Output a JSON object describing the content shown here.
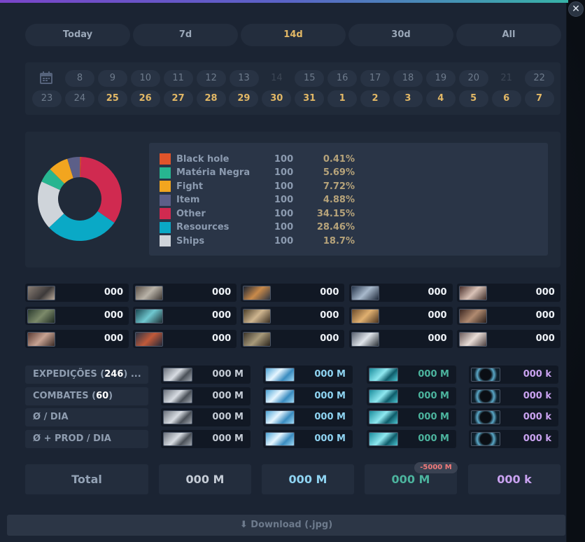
{
  "close_label": "✕",
  "tabs": [
    {
      "label": "Today",
      "active": false
    },
    {
      "label": "7d",
      "active": false
    },
    {
      "label": "14d",
      "active": true
    },
    {
      "label": "30d",
      "active": false
    },
    {
      "label": "All",
      "active": false
    }
  ],
  "calendar": {
    "icon": "calendar-icon",
    "row1": [
      {
        "d": "8",
        "s": "n"
      },
      {
        "d": "9",
        "s": "n"
      },
      {
        "d": "10",
        "s": "n"
      },
      {
        "d": "11",
        "s": "n"
      },
      {
        "d": "12",
        "s": "n"
      },
      {
        "d": "13",
        "s": "n"
      },
      {
        "d": "14",
        "s": "dis"
      },
      {
        "d": "15",
        "s": "n"
      },
      {
        "d": "16",
        "s": "n"
      },
      {
        "d": "17",
        "s": "n"
      },
      {
        "d": "18",
        "s": "n"
      },
      {
        "d": "19",
        "s": "n"
      },
      {
        "d": "20",
        "s": "n"
      },
      {
        "d": "21",
        "s": "dis"
      },
      {
        "d": "22",
        "s": "n"
      }
    ],
    "row2": [
      {
        "d": "23",
        "s": "n"
      },
      {
        "d": "24",
        "s": "n"
      },
      {
        "d": "25",
        "s": "sel"
      },
      {
        "d": "26",
        "s": "sel"
      },
      {
        "d": "27",
        "s": "sel"
      },
      {
        "d": "28",
        "s": "sel"
      },
      {
        "d": "29",
        "s": "sel"
      },
      {
        "d": "30",
        "s": "sel"
      },
      {
        "d": "31",
        "s": "sel"
      },
      {
        "d": "1",
        "s": "sel"
      },
      {
        "d": "2",
        "s": "sel"
      },
      {
        "d": "3",
        "s": "sel"
      },
      {
        "d": "4",
        "s": "sel"
      },
      {
        "d": "5",
        "s": "sel"
      },
      {
        "d": "6",
        "s": "sel"
      },
      {
        "d": "7",
        "s": "sel"
      }
    ]
  },
  "legend": [
    {
      "name": "Black hole",
      "count": "100",
      "pct": "0.41%",
      "color": "#e0542a"
    },
    {
      "name": "Matéria Negra",
      "count": "100",
      "pct": "5.69%",
      "color": "#27b590"
    },
    {
      "name": "Fight",
      "count": "100",
      "pct": "7.72%",
      "color": "#f2a51f"
    },
    {
      "name": "Item",
      "count": "100",
      "pct": "4.88%",
      "color": "#5c5f88"
    },
    {
      "name": "Other",
      "count": "100",
      "pct": "34.15%",
      "color": "#d02a50"
    },
    {
      "name": "Resources",
      "count": "100",
      "pct": "28.46%",
      "color": "#0aa9c6"
    },
    {
      "name": "Ships",
      "count": "100",
      "pct": "18.7%",
      "color": "#cfd4da"
    }
  ],
  "chart_data": {
    "type": "pie",
    "categories": [
      "Other",
      "Resources",
      "Ships",
      "Matéria Negra",
      "Fight",
      "Item",
      "Black hole"
    ],
    "values": [
      34.15,
      28.46,
      18.7,
      5.69,
      7.72,
      4.88,
      0.41
    ],
    "colors": [
      "#d02a50",
      "#0aa9c6",
      "#cfd4da",
      "#27b590",
      "#f2a51f",
      "#5c5f88",
      "#e0542a"
    ]
  },
  "ships": [
    {
      "icon": "ship-1-icon",
      "value": "000"
    },
    {
      "icon": "ship-2-icon",
      "value": "000"
    },
    {
      "icon": "ship-3-icon",
      "value": "000"
    },
    {
      "icon": "ship-4-icon",
      "value": "000"
    },
    {
      "icon": "ship-5-icon",
      "value": "000"
    },
    {
      "icon": "ship-6-icon",
      "value": "000"
    },
    {
      "icon": "ship-7-icon",
      "value": "000"
    },
    {
      "icon": "ship-8-icon",
      "value": "000"
    },
    {
      "icon": "ship-9-icon",
      "value": "000"
    },
    {
      "icon": "ship-10-icon",
      "value": "000"
    },
    {
      "icon": "ship-11-icon",
      "value": "000"
    },
    {
      "icon": "ship-12-icon",
      "value": "000"
    },
    {
      "icon": "ship-13-icon",
      "value": "000"
    },
    {
      "icon": "ship-14-icon",
      "value": "000"
    },
    {
      "icon": "ship-15-icon",
      "value": "000"
    }
  ],
  "stats": [
    {
      "label": "EXPEDIÇÕES (",
      "count": "246",
      "suffix": ") ...",
      "metal": "000 M",
      "crystal": "000 M",
      "deut": "000 M",
      "dm": "000 k"
    },
    {
      "label": "COMBATES (",
      "count": "60",
      "suffix": ")",
      "metal": "000 M",
      "crystal": "000 M",
      "deut": "000 M",
      "dm": "000 k"
    },
    {
      "label": "Ø / DIA",
      "count": "",
      "suffix": "",
      "metal": "000 M",
      "crystal": "000 M",
      "deut": "000 M",
      "dm": "000 k"
    },
    {
      "label": "Ø + PROD / DIA",
      "count": "",
      "suffix": "",
      "metal": "000 M",
      "crystal": "000 M",
      "deut": "000 M",
      "dm": "000 k"
    }
  ],
  "totals": {
    "label": "Total",
    "metal": "000 M",
    "crystal": "000 M",
    "deut": "000 M",
    "dm": "000 k",
    "deut_badge": "-5000 M"
  },
  "download_label": "Download (.jpg)"
}
